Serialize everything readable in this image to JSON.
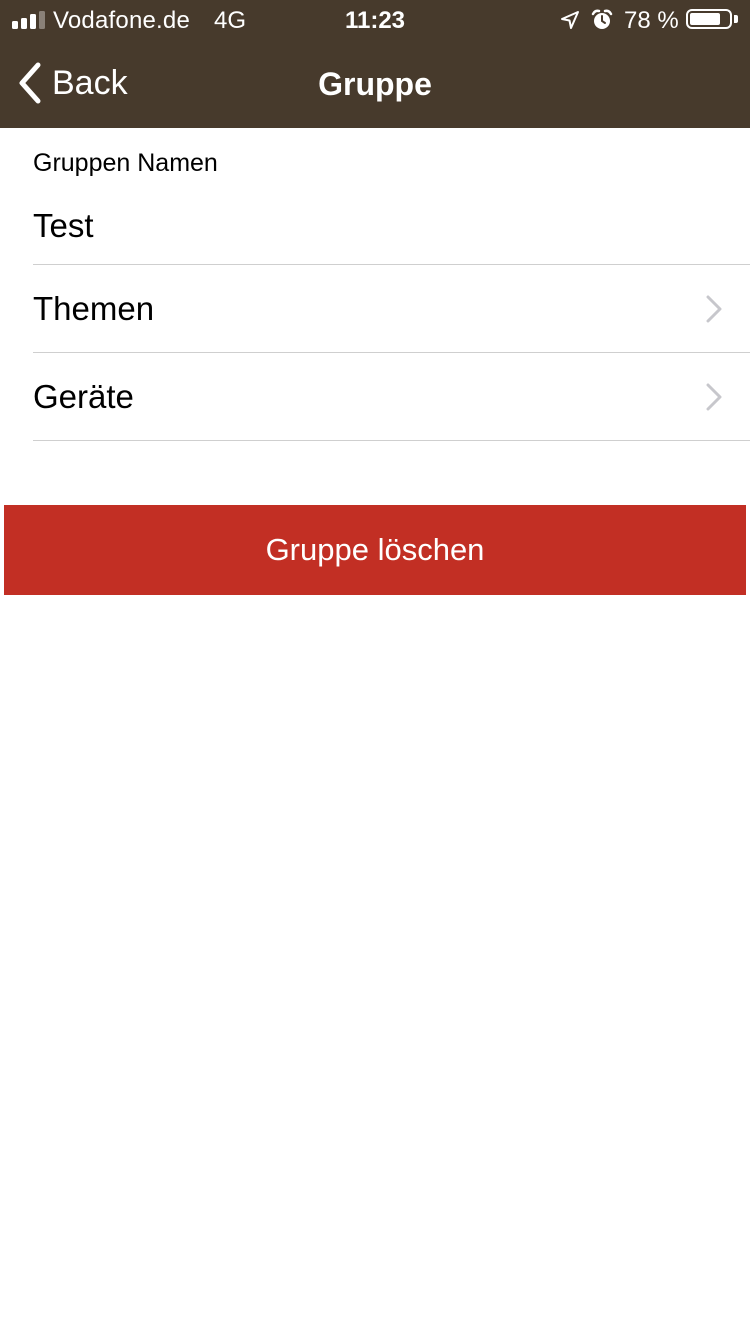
{
  "status_bar": {
    "carrier": "Vodafone.de",
    "network": "4G",
    "time": "11:23",
    "battery_percent_label": "78 %",
    "battery_level": 0.78,
    "signal_bars_filled": 3,
    "signal_bars_total": 4,
    "icons": [
      "signal-icon",
      "location-icon",
      "alarm-icon",
      "battery-icon"
    ]
  },
  "nav": {
    "back_label": "Back",
    "title": "Gruppe",
    "back_icon": "chevron-left-icon"
  },
  "form": {
    "group_name_label": "Gruppen Namen",
    "group_name_value": "Test"
  },
  "rows": [
    {
      "label": "Themen",
      "icon": "chevron-right-icon"
    },
    {
      "label": "Geräte",
      "icon": "chevron-right-icon"
    }
  ],
  "delete_button": {
    "label": "Gruppe löschen"
  },
  "colors": {
    "nav_background": "#473a2c",
    "delete_button": "#c22f24",
    "separator": "#cfcfcf",
    "chevron": "#c7c7cc"
  }
}
